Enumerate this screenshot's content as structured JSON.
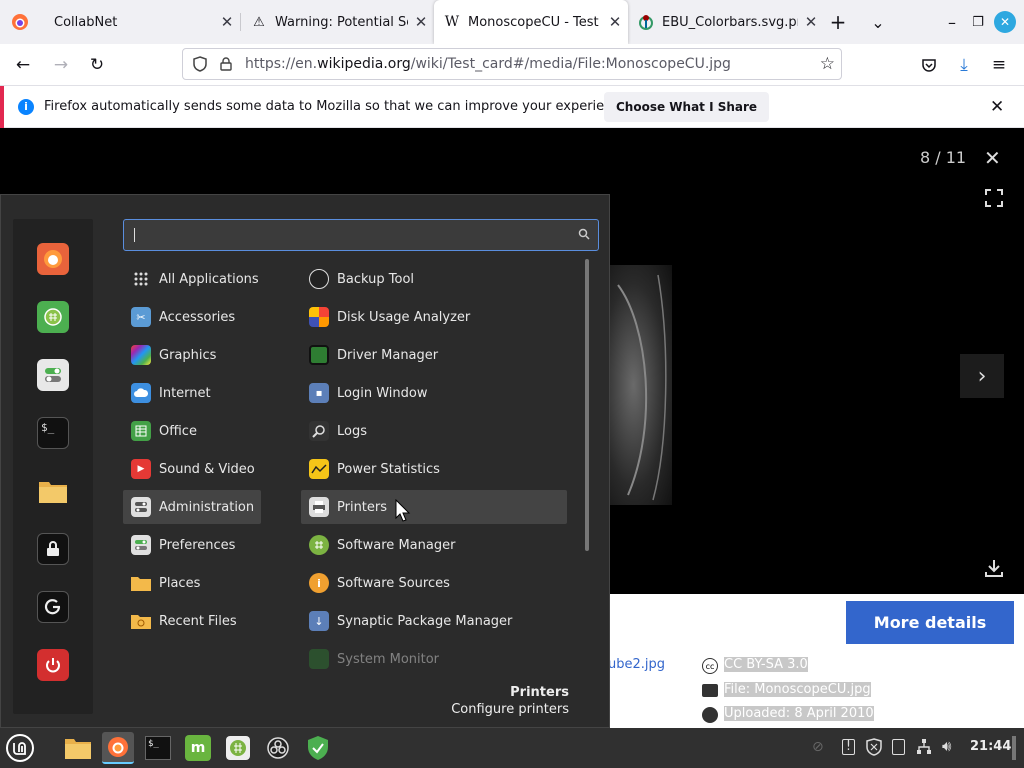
{
  "tabs": [
    {
      "title": "CollabNet",
      "favicon": "firefox-icon"
    },
    {
      "title": "Warning: Potential Sec",
      "favicon": "warning-icon"
    },
    {
      "title": "MonoscopeCU - Test ca",
      "favicon": "wikipedia-icon"
    },
    {
      "title": "EBU_Colorbars.svg.png",
      "favicon": "wikimedia-icon"
    }
  ],
  "url": {
    "prefix": "https://en.",
    "domain": "wikipedia.org",
    "path": "/wiki/Test_card#/media/File:MonoscopeCU.jpg"
  },
  "notification": {
    "text": "Firefox automatically sends some data to Mozilla so that we can improve your experience.",
    "button": "Choose What I Share"
  },
  "viewer": {
    "counter": "8 / 11",
    "more_details": "More details",
    "link_text": "ube2.jpg",
    "license": "CC BY-SA 3.0",
    "file": "File: MonoscopeCU.jpg",
    "uploaded": "Uploaded: 8 April 2010"
  },
  "menu": {
    "search_placeholder": "",
    "categories": [
      "All Applications",
      "Accessories",
      "Graphics",
      "Internet",
      "Office",
      "Sound & Video",
      "Administration",
      "Preferences",
      "Places",
      "Recent Files"
    ],
    "apps": [
      "Backup Tool",
      "Disk Usage Analyzer",
      "Driver Manager",
      "Login Window",
      "Logs",
      "Power Statistics",
      "Printers",
      "Software Manager",
      "Software Sources",
      "Synaptic Package Manager",
      "System Monitor"
    ],
    "tooltip_title": "Printers",
    "tooltip_desc": "Configure printers"
  },
  "taskbar": {
    "clock": "21:44"
  },
  "colors": {
    "accent": "#2a5bd7",
    "menu_bg": "#2b2b2b",
    "mint_green": "#69b53f"
  }
}
